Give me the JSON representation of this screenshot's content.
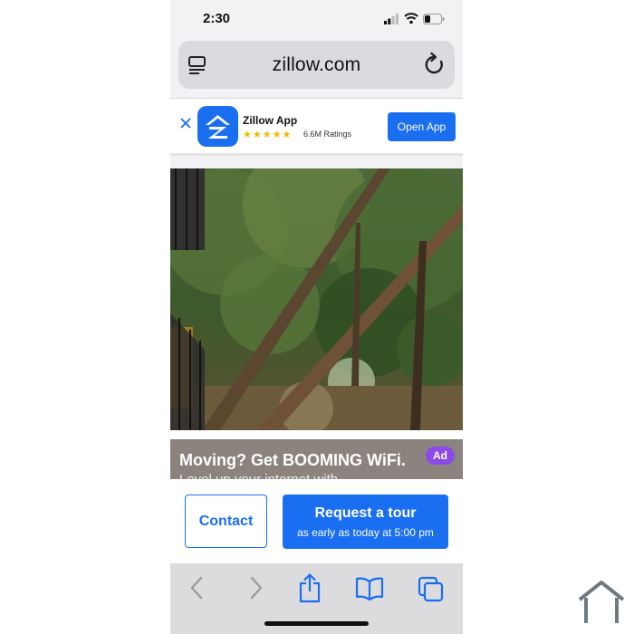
{
  "status_bar": {
    "time": "2:30"
  },
  "browser": {
    "url": "zillow.com"
  },
  "app_banner": {
    "app_name": "Zillow App",
    "stars": "★★★★★",
    "ratings": "6.6M Ratings",
    "open_label": "Open App"
  },
  "ad": {
    "title": "Moving? Get BOOMING WiFi.",
    "subtitle": "Level up your internet with",
    "badge": "Ad"
  },
  "actions": {
    "contact_label": "Contact",
    "tour_label": "Request a tour",
    "tour_sub": "as early as today at 5:00 pm"
  },
  "colors": {
    "brand": "#1a6ef0",
    "ad_badge": "#8c4be8",
    "stars": "#f5b800"
  }
}
